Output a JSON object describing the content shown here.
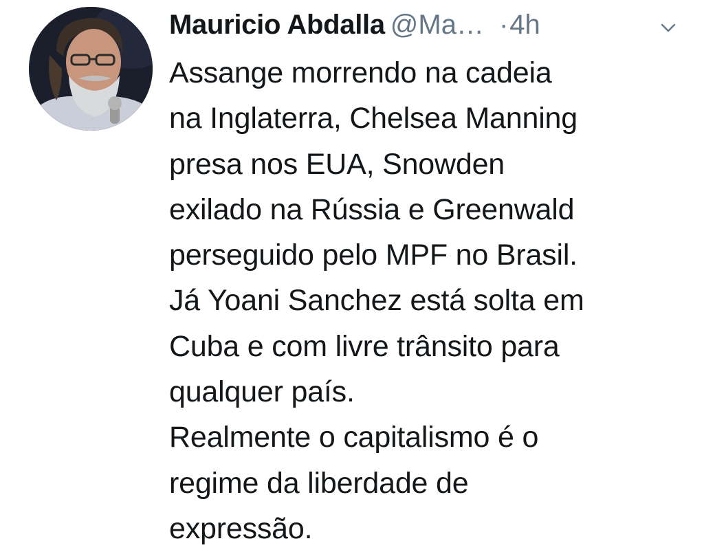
{
  "tweet": {
    "author": {
      "display_name": "Mauricio Abdalla",
      "handle": "@Ma…"
    },
    "separator": "·",
    "timestamp": "4h",
    "menu_icon": "chevron-down-icon",
    "avatar_icon": "profile-photo",
    "text": "Assange morrendo na cadeia\nna Inglaterra, Chelsea Manning\npresa nos EUA, Snowden\nexilado na Rússia e Greenwald\nperseguido pelo MPF no Brasil.\nJá Yoani Sanchez está solta em\nCuba e com livre trânsito para\nqualquer país.\nRealmente o capitalismo é o\nregime da liberdade de\nexpressão."
  },
  "colors": {
    "primary_text": "#14171a",
    "secondary_text": "#657786",
    "background": "#ffffff"
  }
}
